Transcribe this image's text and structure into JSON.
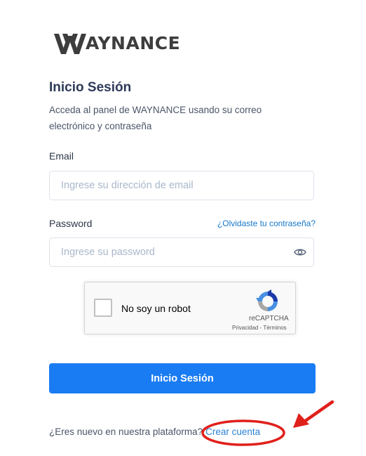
{
  "brand": {
    "logo_text": "AYNANCE",
    "logo_mark": "W"
  },
  "login": {
    "title": "Inicio Sesión",
    "subtitle": "Acceda al panel de WAYNANCE usando su correo electrónico y contraseña",
    "email_label": "Email",
    "email_placeholder": "Ingrese su dirección de email",
    "email_value": "",
    "password_label": "Password",
    "password_placeholder": "Ingrese su password",
    "password_value": "",
    "forgot_link": "¿Olvidaste tu contraseña?",
    "submit_label": "Inicio Sesión"
  },
  "captcha": {
    "label": "No soy un robot",
    "brand": "reCAPTCHA",
    "links": "Privacidad - Términos",
    "checked": false
  },
  "signup": {
    "prompt": "¿Eres nuevo en nuestra plataforma?",
    "link": "Crear cuenta"
  },
  "colors": {
    "primary": "#1a7cf3",
    "link": "#2b83d6",
    "annotation": "#e0201b"
  },
  "icons": [
    "eye-icon",
    "recaptcha-logo-icon"
  ]
}
